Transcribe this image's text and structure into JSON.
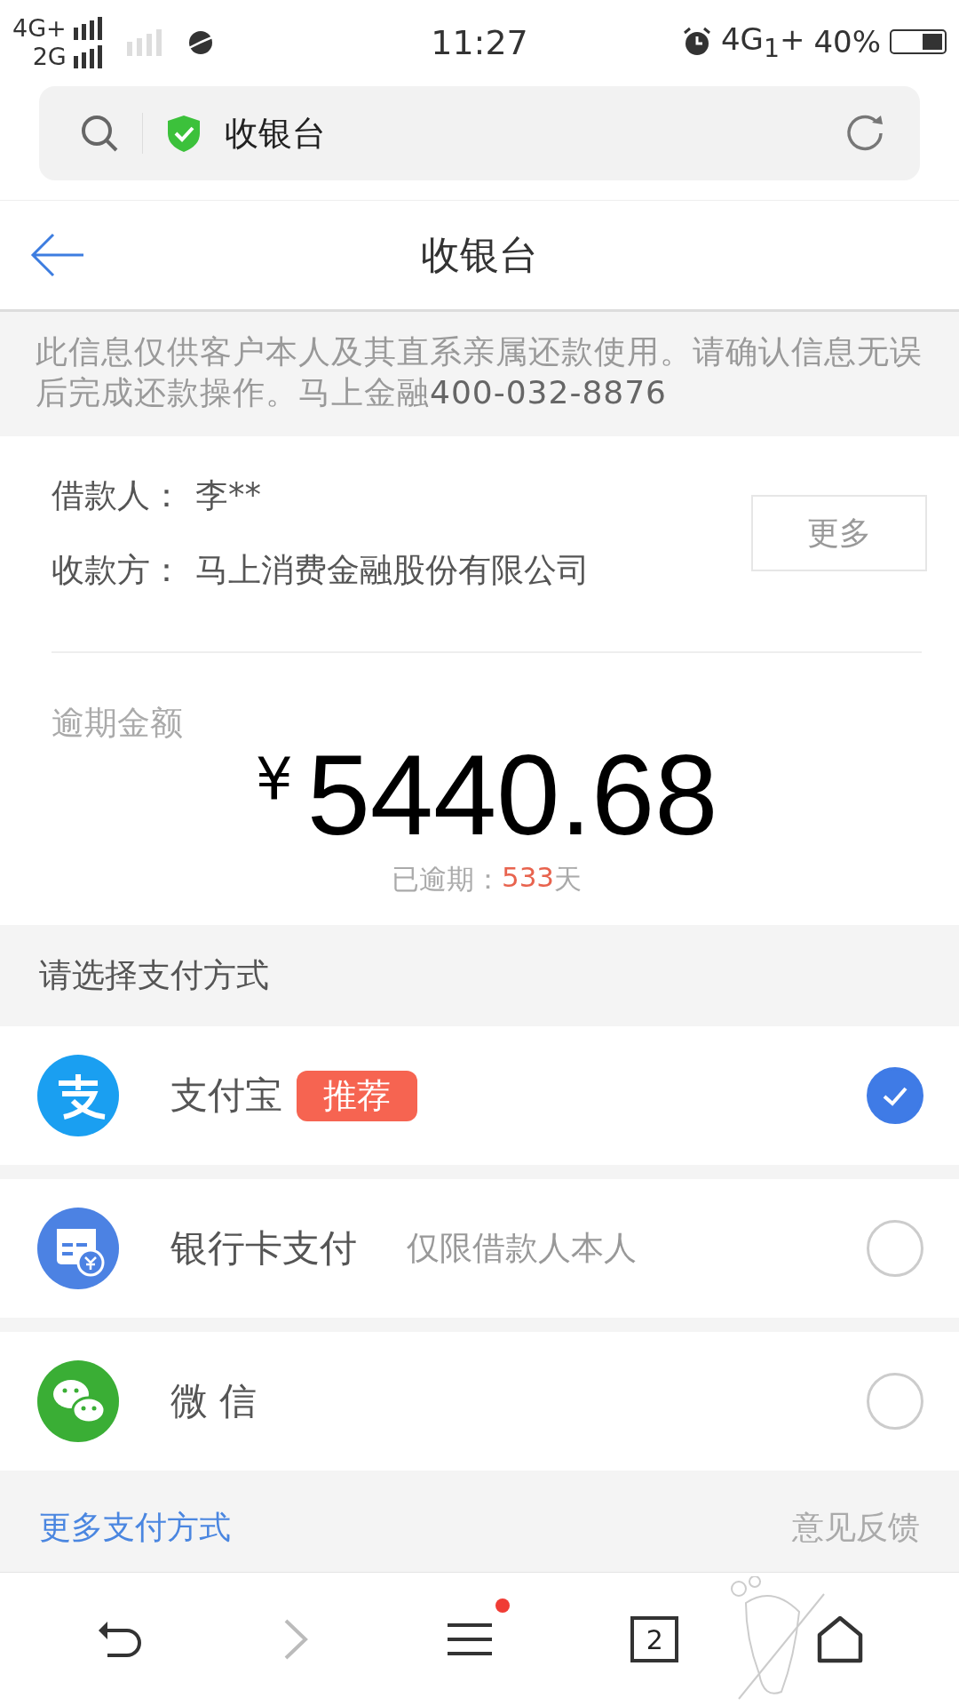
{
  "status_bar": {
    "networks": [
      "4G+",
      "2G"
    ],
    "time": "11:27",
    "right_network": "4G$_{1}$+",
    "battery": {
      "text": "40%",
      "level": 0.4
    }
  },
  "address_bar": {
    "title": "收银台"
  },
  "header": {
    "title": "收银台"
  },
  "notice": {
    "text": "此信息仅供客户本人及其直系亲属还款使用。请确认信息无误后完成还款操作。马上金融",
    "phone": "400-032-8876"
  },
  "parties": [
    {
      "label": "借款人：",
      "value": "李**"
    },
    {
      "label": "收款方：",
      "value": "马上消费金融股份有限公司"
    }
  ],
  "more_button": "更多",
  "overdue": {
    "label": "逾期金额",
    "currency": "¥",
    "amount": "5440.68",
    "days_label": "已逾期：",
    "days": "533",
    "days_unit": "天"
  },
  "payment_title": "请选择支付方式",
  "methods": [
    {
      "kind": "alipay",
      "name": "支付宝",
      "badge": "推荐",
      "selected": true
    },
    {
      "kind": "bank",
      "name": "银行卡支付",
      "note": "仅限借款人本人",
      "selected": false
    },
    {
      "kind": "wechat",
      "name": "微 信",
      "selected": false
    }
  ],
  "footer_links": [
    "更多支付方式",
    "意见反馈"
  ],
  "toolbar": {
    "menu_dot": true,
    "tabs_count": "2"
  }
}
